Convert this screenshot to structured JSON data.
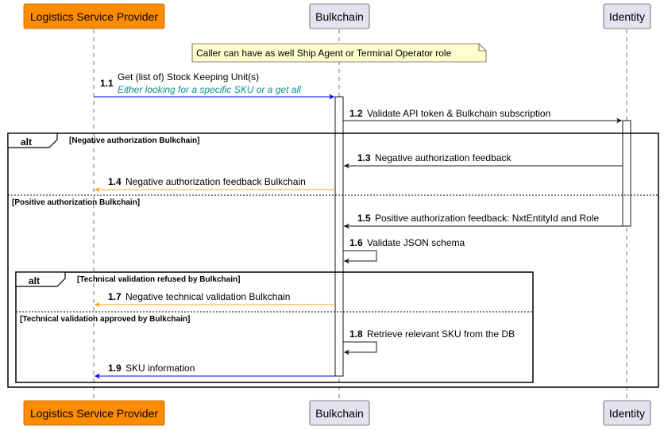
{
  "participants": {
    "lsp": {
      "label": "Logistics Service Provider",
      "fill": "#ff8c00",
      "stroke": "#b35f00"
    },
    "bulkchain": {
      "label": "Bulkchain",
      "fill": "#e2e2f0",
      "stroke": "#181818"
    },
    "identity": {
      "label": "Identity",
      "fill": "#e2e2f0",
      "stroke": "#181818"
    }
  },
  "note": {
    "text": "Caller can have as well Ship Agent or Terminal Operator role"
  },
  "messages": {
    "m1": {
      "num": "1.1",
      "text": "Get (list of) Stock Keeping Unit(s)",
      "note": "Either looking for a specific SKU or a get all",
      "color": "#0000ff"
    },
    "m2": {
      "num": "1.2",
      "text": "Validate API token & Bulkchain subscription",
      "color": "#181818"
    },
    "m3": {
      "num": "1.3",
      "text": "Negative authorization feedback",
      "color": "#181818"
    },
    "m4": {
      "num": "1.4",
      "text": "Negative authorization feedback Bulkchain",
      "color": "#f5a623"
    },
    "m5": {
      "num": "1.5",
      "text": "Positive authorization feedback: NxtEntityId and Role",
      "color": "#181818"
    },
    "m6": {
      "num": "1.6",
      "text": "Validate JSON schema",
      "color": "#181818"
    },
    "m7": {
      "num": "1.7",
      "text": "Negative technical validation Bulkchain",
      "color": "#f5a623"
    },
    "m8": {
      "num": "1.8",
      "text": "Retrieve relevant SKU from the DB",
      "color": "#181818"
    },
    "m9": {
      "num": "1.9",
      "text": "SKU information",
      "color": "#0000ff"
    }
  },
  "frames": {
    "outer": {
      "keyword": "alt",
      "guard1": "[Negative authorization Bulkchain]",
      "guard2": "[Positive authorization Bulkchain]"
    },
    "inner": {
      "keyword": "alt",
      "guard1": "[Technical validation refused by Bulkchain]",
      "guard2": "[Technical validation approved by Bulkchain]"
    }
  }
}
